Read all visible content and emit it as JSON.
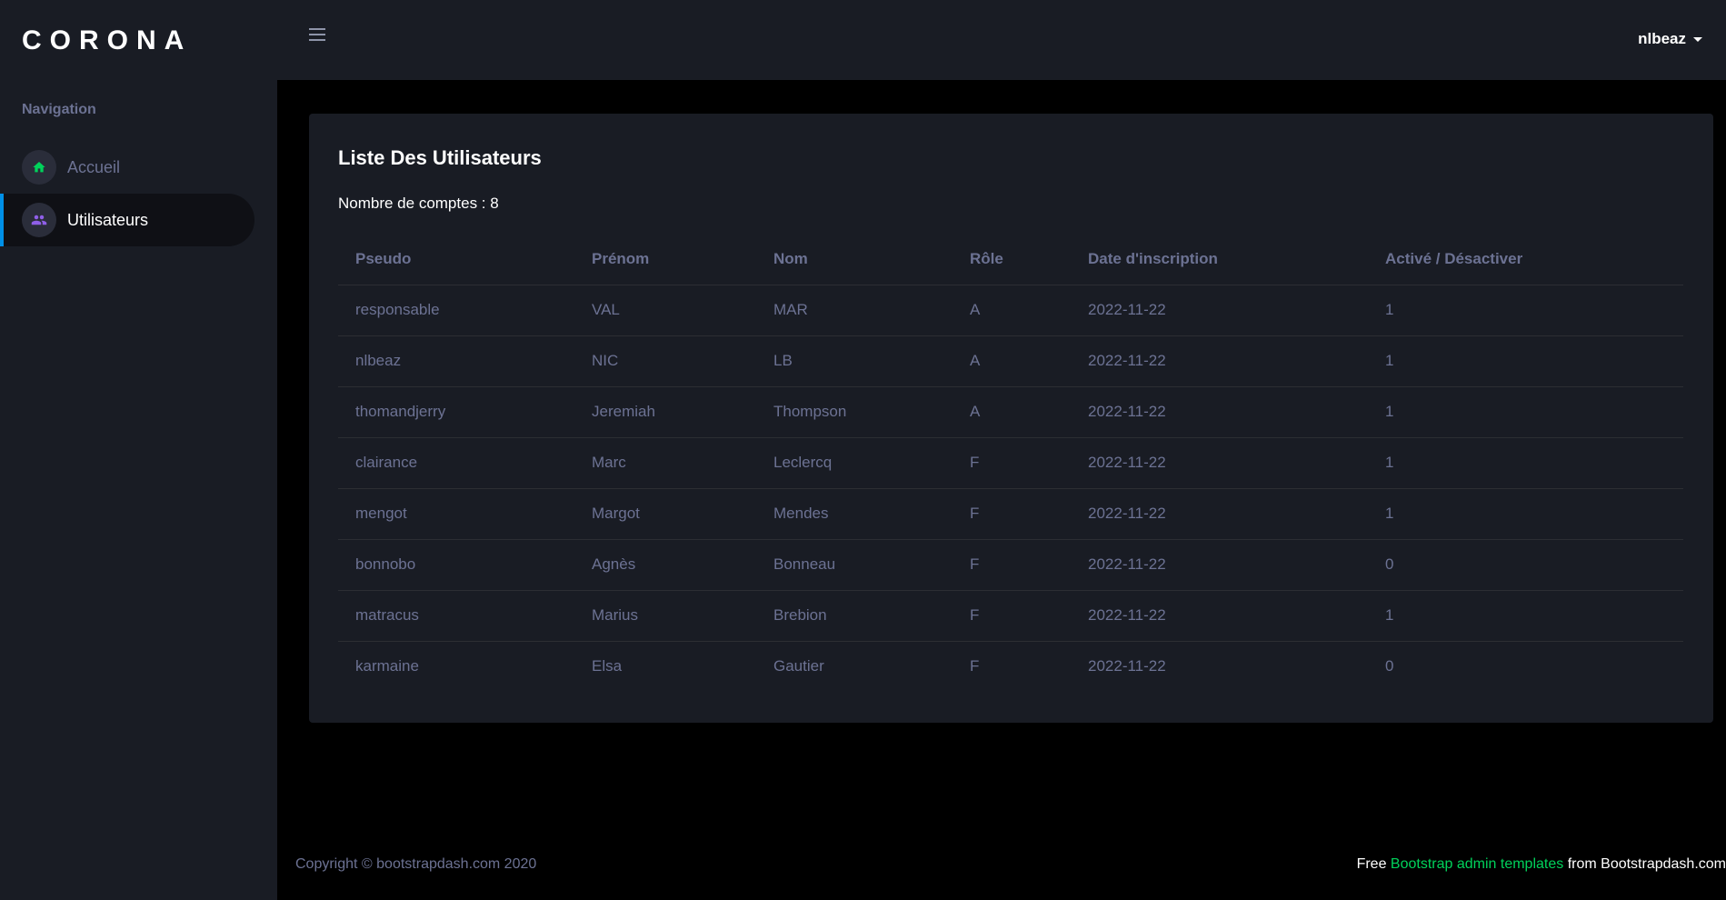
{
  "brand": "CORONA",
  "sidebar": {
    "heading": "Navigation",
    "items": [
      {
        "label": "Accueil",
        "icon": "home-icon",
        "color": "#00d25b"
      },
      {
        "label": "Utilisateurs",
        "icon": "users-icon",
        "color": "#8f5fe8"
      }
    ]
  },
  "topbar": {
    "username": "nlbeaz"
  },
  "card": {
    "title": "Liste Des Utilisateurs",
    "count_text": "Nombre de comptes : 8"
  },
  "table": {
    "headers": [
      "Pseudo",
      "Prénom",
      "Nom",
      "Rôle",
      "Date d'inscription",
      "Activé / Désactiver"
    ],
    "rows": [
      [
        "responsable",
        "VAL",
        "MAR",
        "A",
        "2022-11-22",
        "1"
      ],
      [
        "nlbeaz",
        "NIC",
        "LB",
        "A",
        "2022-11-22",
        "1"
      ],
      [
        "thomandjerry",
        "Jeremiah",
        "Thompson",
        "A",
        "2022-11-22",
        "1"
      ],
      [
        "clairance",
        "Marc",
        "Leclercq",
        "F",
        "2022-11-22",
        "1"
      ],
      [
        "mengot",
        "Margot",
        "Mendes",
        "F",
        "2022-11-22",
        "1"
      ],
      [
        "bonnobo",
        "Agnès",
        "Bonneau",
        "F",
        "2022-11-22",
        "0"
      ],
      [
        "matracus",
        "Marius",
        "Brebion",
        "F",
        "2022-11-22",
        "1"
      ],
      [
        "karmaine",
        "Elsa",
        "Gautier",
        "F",
        "2022-11-22",
        "0"
      ]
    ]
  },
  "footer": {
    "copyright": "Copyright © bootstrapdash.com 2020",
    "free": "Free ",
    "link": "Bootstrap admin templates",
    "from": " from Bootstrapdash.com"
  },
  "colors": {
    "accent_blue": "#0090e7",
    "accent_green": "#00d25b",
    "accent_purple": "#8f5fe8"
  }
}
